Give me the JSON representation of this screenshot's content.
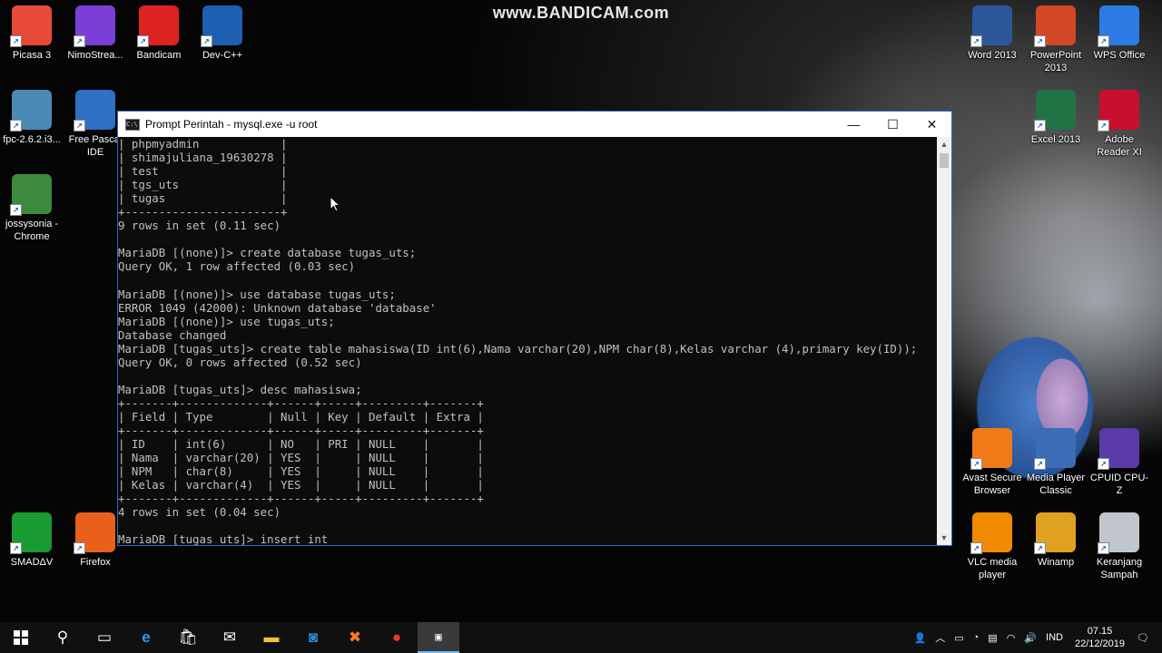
{
  "watermark": "www.BANDICAM.com",
  "desktop_icons": [
    {
      "label": "Picasa 3",
      "icon": "picasa-icon",
      "color": "#e84a3a"
    },
    {
      "label": "NimoStrea...",
      "icon": "nimo-icon",
      "color": "#7a3fd6"
    },
    {
      "label": "Bandicam",
      "icon": "bandicam-icon",
      "color": "#d22"
    },
    {
      "label": "Dev-C++",
      "icon": "devcpp-icon",
      "color": "#1d5fb0"
    },
    {
      "label": "fpc-2.6.2.i3...",
      "icon": "fpc-installer-icon",
      "color": "#4a8ab5"
    },
    {
      "label": "Free Pascal IDE",
      "icon": "freepascal-icon",
      "color": "#2f6fc4"
    },
    {
      "label": "jossysonia - Chrome",
      "icon": "chrome-icon",
      "color": "#3c8b3c"
    },
    {
      "label": "SMADΔV",
      "icon": "smadav-icon",
      "color": "#1a9a32"
    },
    {
      "label": "Firefox",
      "icon": "firefox-icon",
      "color": "#e8601c"
    },
    {
      "label": "Word 2013",
      "icon": "word-icon",
      "color": "#2b579a"
    },
    {
      "label": "PowerPoint 2013",
      "icon": "powerpoint-icon",
      "color": "#d24726"
    },
    {
      "label": "WPS Office",
      "icon": "wps-icon",
      "color": "#2d7be5"
    },
    {
      "label": "Excel 2013",
      "icon": "excel-icon",
      "color": "#217346"
    },
    {
      "label": "Adobe Reader XI",
      "icon": "adobe-reader-icon",
      "color": "#c8102e"
    },
    {
      "label": "Avast Secure Browser",
      "icon": "avast-icon",
      "color": "#f07a17"
    },
    {
      "label": "Media Player Classic",
      "icon": "mpc-icon",
      "color": "#3a6db5"
    },
    {
      "label": "CPUID CPU-Z",
      "icon": "cpuz-icon",
      "color": "#5a3aa8"
    },
    {
      "label": "VLC media player",
      "icon": "vlc-icon",
      "color": "#f08a00"
    },
    {
      "label": "Winamp",
      "icon": "winamp-icon",
      "color": "#e0a020"
    },
    {
      "label": "Keranjang Sampah",
      "icon": "recycle-bin-icon",
      "color": "#c0c6cc"
    }
  ],
  "window": {
    "title": "Prompt Perintah - mysql.exe  -u root",
    "minimize": "—",
    "maximize": "☐",
    "close": "✕"
  },
  "console_lines": [
    "| phpmyadmin            |",
    "| shimajuliana_19630278 |",
    "| test                  |",
    "| tgs_uts               |",
    "| tugas                 |",
    "+-----------------------+",
    "9 rows in set (0.11 sec)",
    "",
    "MariaDB [(none)]> create database tugas_uts;",
    "Query OK, 1 row affected (0.03 sec)",
    "",
    "MariaDB [(none)]> use database tugas_uts;",
    "ERROR 1049 (42000): Unknown database 'database'",
    "MariaDB [(none)]> use tugas_uts;",
    "Database changed",
    "MariaDB [tugas_uts]> create table mahasiswa(ID int(6),Nama varchar(20),NPM char(8),Kelas varchar (4),primary key(ID));",
    "Query OK, 0 rows affected (0.52 sec)",
    "",
    "MariaDB [tugas_uts]> desc mahasiswa;",
    "+-------+-------------+------+-----+---------+-------+",
    "| Field | Type        | Null | Key | Default | Extra |",
    "+-------+-------------+------+-----+---------+-------+",
    "| ID    | int(6)      | NO   | PRI | NULL    |       |",
    "| Nama  | varchar(20) | YES  |     | NULL    |       |",
    "| NPM   | char(8)     | YES  |     | NULL    |       |",
    "| Kelas | varchar(4)  | YES  |     | NULL    |       |",
    "+-------+-------------+------+-----+---------+-------+",
    "4 rows in set (0.04 sec)",
    "",
    "MariaDB [tugas_uts]> insert int"
  ],
  "taskbar": {
    "start": "start-icon",
    "language": "IND",
    "time": "07.15",
    "date": "22/12/2019"
  }
}
